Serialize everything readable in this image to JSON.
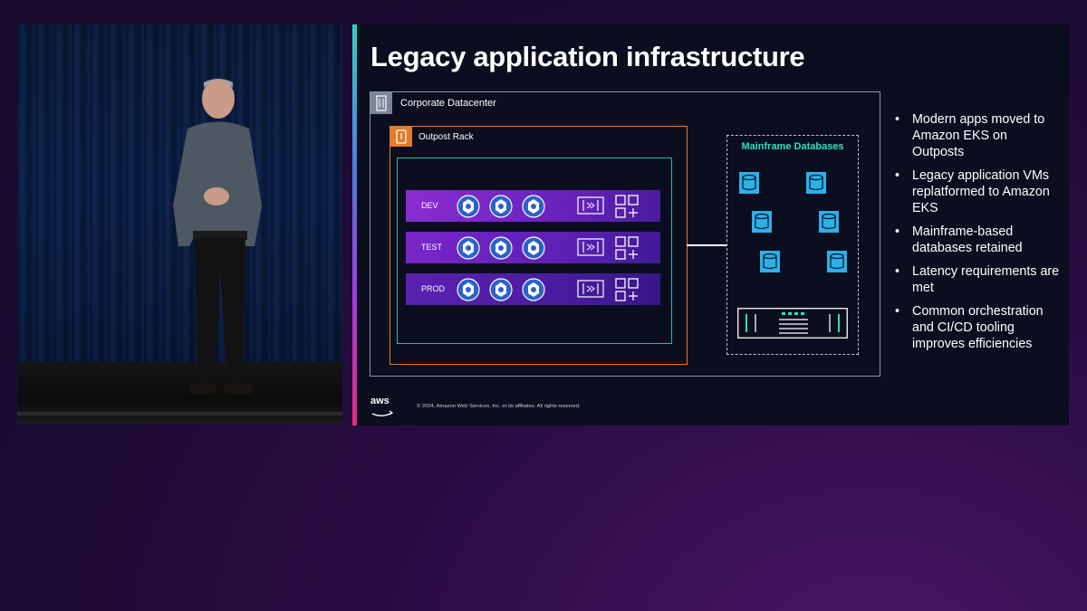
{
  "slide": {
    "title": "Legacy application infrastructure",
    "corporate_label": "Corporate Datacenter",
    "rack_label": "Outpost Rack",
    "environments": [
      {
        "label": "DEV"
      },
      {
        "label": "TEST"
      },
      {
        "label": "PROD"
      }
    ],
    "mainframe_label": "Mainframe Databases",
    "bullets": [
      "Modern apps moved to Amazon EKS on Outposts",
      "Legacy application VMs replatformed to Amazon EKS",
      "Mainframe-based databases retained",
      "Latency requirements are met",
      "Common orchestration and CI/CD tooling improves efficiencies"
    ],
    "bullet_char": "•",
    "copyright": "© 2024, Amazon Web Services, Inc. or its affiliates. All rights reserved.",
    "brand_logo_text": "aws"
  },
  "colors": {
    "accent_orange": "#e37a2c",
    "accent_teal": "#2bb7a8",
    "db_blue": "#2bb0e8",
    "mainframe_green": "#2fe0b8"
  }
}
